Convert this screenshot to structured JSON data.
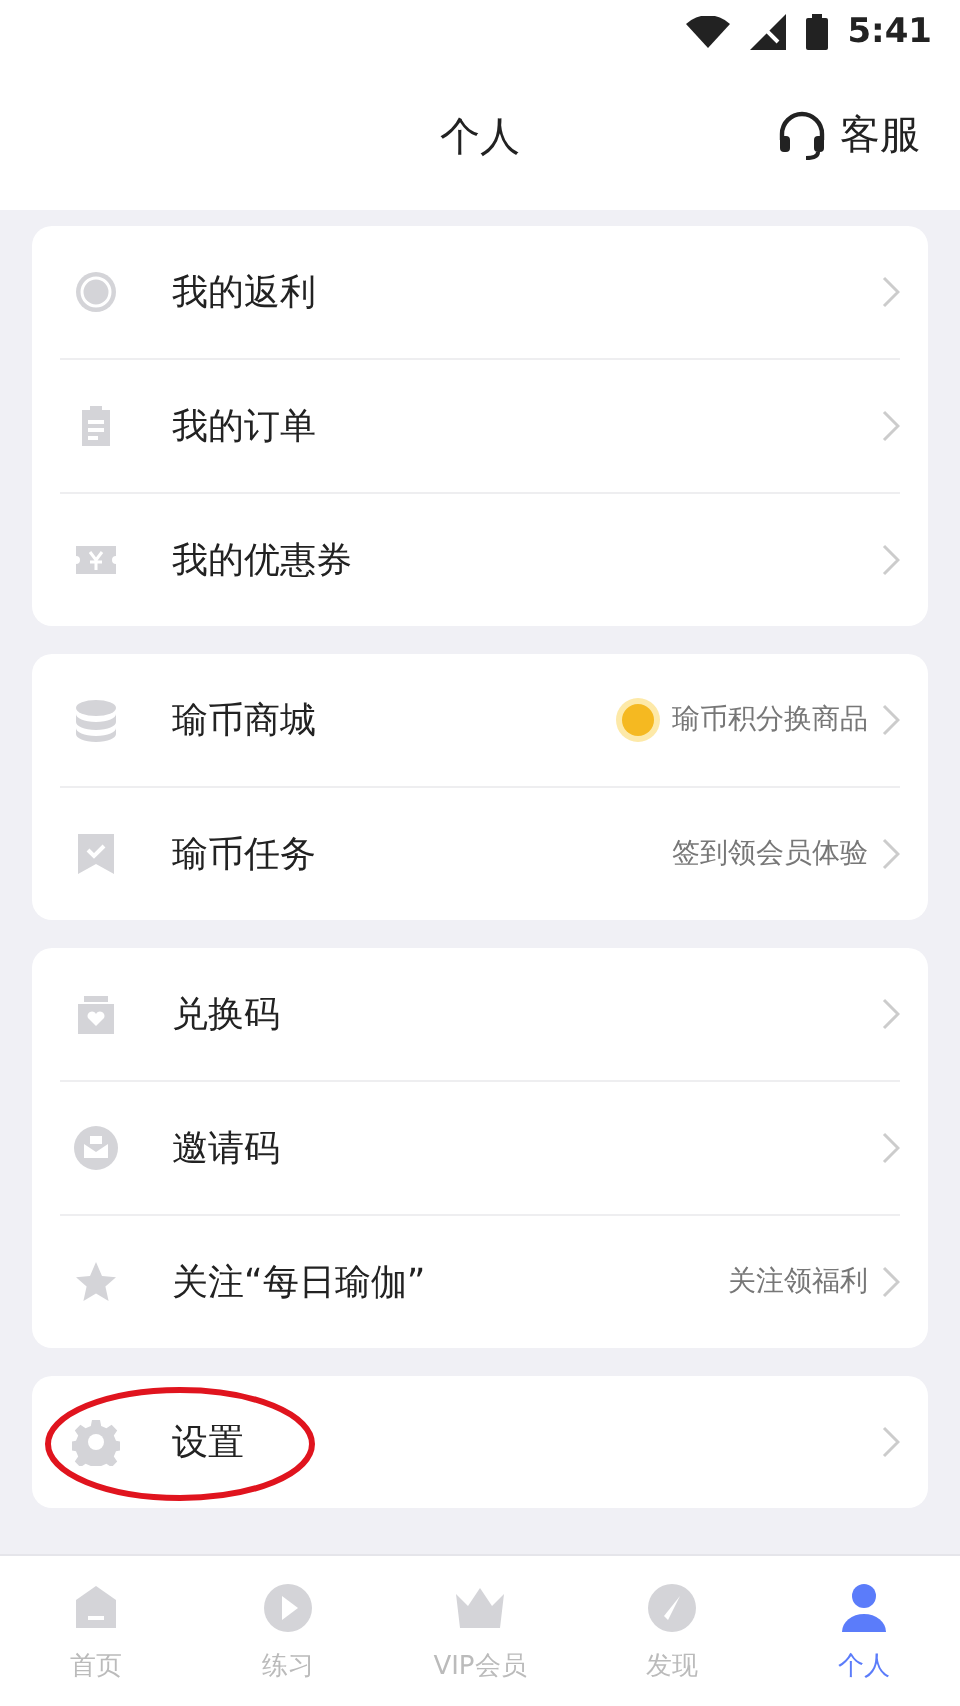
{
  "status_bar": {
    "time": "5:41"
  },
  "header": {
    "title": "个人",
    "service": "客服"
  },
  "groups": [
    {
      "items": [
        {
          "kind": "rebate",
          "label": "我的返利"
        },
        {
          "kind": "order",
          "label": "我的订单"
        },
        {
          "kind": "coupon",
          "label": "我的优惠券"
        }
      ]
    },
    {
      "items": [
        {
          "kind": "coins",
          "label": "瑜币商城",
          "badge": true,
          "hint": "瑜币积分换商品"
        },
        {
          "kind": "task",
          "label": "瑜币任务",
          "hint": "签到领会员体验"
        }
      ]
    },
    {
      "items": [
        {
          "kind": "gift",
          "label": "兑换码"
        },
        {
          "kind": "mail",
          "label": "邀请码"
        },
        {
          "kind": "star",
          "label": "关注“每日瑜伽”",
          "hint": "关注领福利"
        }
      ]
    },
    {
      "items": [
        {
          "kind": "gear",
          "label": "设置",
          "circled": true
        }
      ]
    }
  ],
  "tabs": [
    {
      "kind": "home",
      "label": "首页",
      "selected": false
    },
    {
      "kind": "play",
      "label": "练习",
      "selected": false
    },
    {
      "kind": "crown",
      "label": "VIP会员",
      "selected": false
    },
    {
      "kind": "compass",
      "label": "发现",
      "selected": false
    },
    {
      "kind": "person",
      "label": "个人",
      "selected": true
    }
  ]
}
